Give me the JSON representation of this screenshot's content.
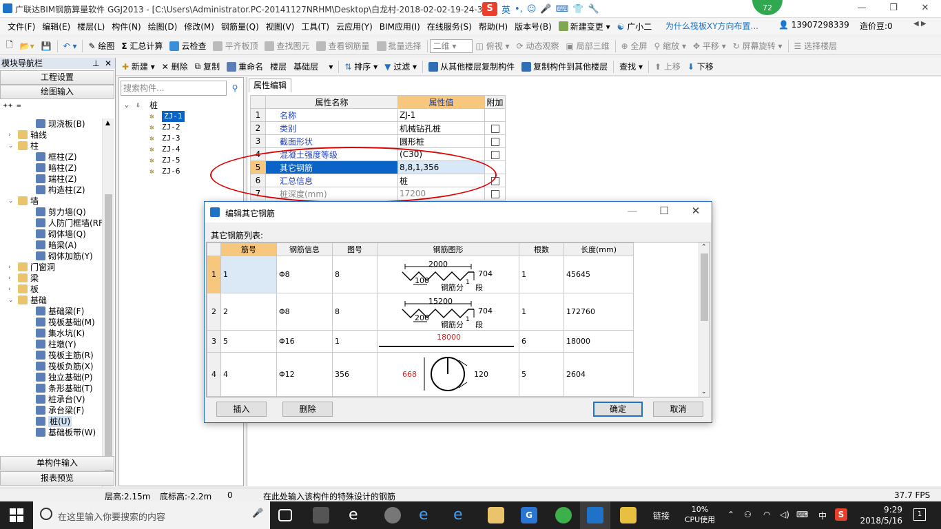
{
  "window": {
    "title": "广联达BIM钢筋算量软件 GGJ2013 - [C:\\Users\\Administrator.PC-20141127NRHM\\Desktop\\白龙村-2018-02-02-19-24-35",
    "ime_label": "英",
    "score": "72",
    "min": "—",
    "max": "❐",
    "close": "✕"
  },
  "menu": {
    "items": [
      "文件(F)",
      "编辑(E)",
      "楼层(L)",
      "构件(N)",
      "绘图(D)",
      "修改(M)",
      "钢筋量(Q)",
      "视图(V)",
      "工具(T)",
      "云应用(Y)",
      "BIM应用(I)",
      "在线服务(S)",
      "帮助(H)",
      "版本号(B)"
    ],
    "new_change": "新建变更",
    "assistant": "广小二",
    "question": "为什么筏板XY方向布置...",
    "phone": "13907298339",
    "beans": "造价豆:0"
  },
  "toolbar1": {
    "draw": "绘图",
    "sum": "汇总计算",
    "cloud_check": "云检查",
    "flush_slab": "平齐板顶",
    "find_element": "查找图元",
    "view_rebar": "查看钢筋量",
    "batch_select": "批量选择",
    "view_mode": "二维",
    "top_view": "俯视",
    "dynamic": "动态观察",
    "local3d": "局部三维",
    "fullscreen": "全屏",
    "zoom": "缩放",
    "pan": "平移",
    "rotate": "屏幕旋转",
    "select_floor": "选择楼层"
  },
  "toolbar2": {
    "nav_title": "模块导航栏",
    "new": "新建",
    "delete": "删除",
    "copy": "复制",
    "rename": "重命名",
    "floor": "楼层",
    "floor_value": "基础层",
    "sort": "排序",
    "filter": "过滤",
    "copy_from": "从其他楼层复制构件",
    "copy_to": "复制构件到其他楼层",
    "find": "查找",
    "up": "上移",
    "down": "下移"
  },
  "leftnav": {
    "project_settings": "工程设置",
    "drawing_input": "绘图输入",
    "single_input": "单构件输入",
    "report_preview": "报表预览",
    "tree": [
      {
        "label": "现浇板(B)",
        "level": 2,
        "type": "item"
      },
      {
        "label": "轴线",
        "level": 1,
        "type": "folder",
        "exp": "›"
      },
      {
        "label": "柱",
        "level": 1,
        "type": "folder",
        "exp": "⌄"
      },
      {
        "label": "框柱(Z)",
        "level": 2,
        "type": "item"
      },
      {
        "label": "暗柱(Z)",
        "level": 2,
        "type": "item"
      },
      {
        "label": "端柱(Z)",
        "level": 2,
        "type": "item"
      },
      {
        "label": "构造柱(Z)",
        "level": 2,
        "type": "item"
      },
      {
        "label": "墙",
        "level": 1,
        "type": "folder",
        "exp": "⌄"
      },
      {
        "label": "剪力墙(Q)",
        "level": 2,
        "type": "item"
      },
      {
        "label": "人防门框墙(RF",
        "level": 2,
        "type": "item"
      },
      {
        "label": "砌体墙(Q)",
        "level": 2,
        "type": "item"
      },
      {
        "label": "暗梁(A)",
        "level": 2,
        "type": "item"
      },
      {
        "label": "砌体加筋(Y)",
        "level": 2,
        "type": "item"
      },
      {
        "label": "门窗洞",
        "level": 1,
        "type": "folder",
        "exp": "›"
      },
      {
        "label": "梁",
        "level": 1,
        "type": "folder",
        "exp": "›"
      },
      {
        "label": "板",
        "level": 1,
        "type": "folder",
        "exp": "›"
      },
      {
        "label": "基础",
        "level": 1,
        "type": "folder",
        "exp": "⌄"
      },
      {
        "label": "基础梁(F)",
        "level": 2,
        "type": "item"
      },
      {
        "label": "筏板基础(M)",
        "level": 2,
        "type": "item"
      },
      {
        "label": "集水坑(K)",
        "level": 2,
        "type": "item"
      },
      {
        "label": "柱墩(Y)",
        "level": 2,
        "type": "item"
      },
      {
        "label": "筏板主筋(R)",
        "level": 2,
        "type": "item"
      },
      {
        "label": "筏板负筋(X)",
        "level": 2,
        "type": "item"
      },
      {
        "label": "独立基础(P)",
        "level": 2,
        "type": "item"
      },
      {
        "label": "条形基础(T)",
        "level": 2,
        "type": "item"
      },
      {
        "label": "桩承台(V)",
        "level": 2,
        "type": "item"
      },
      {
        "label": "承台梁(F)",
        "level": 2,
        "type": "item"
      },
      {
        "label": "桩(U)",
        "level": 2,
        "type": "item",
        "selected": true
      },
      {
        "label": "基础板带(W)",
        "level": 2,
        "type": "item"
      }
    ]
  },
  "comptree": {
    "search_placeholder": "搜索构件...",
    "root": "桩",
    "items": [
      "ZJ-1",
      "ZJ-2",
      "ZJ-3",
      "ZJ-4",
      "ZJ-5",
      "ZJ-6"
    ]
  },
  "props": {
    "tab": "属性编辑",
    "col_name": "属性名称",
    "col_value": "属性值",
    "col_extra": "附加",
    "rows": [
      {
        "n": "1",
        "name": "名称",
        "value": "ZJ-1",
        "chk": false
      },
      {
        "n": "2",
        "name": "类别",
        "value": "机械钻孔桩",
        "chk": true
      },
      {
        "n": "3",
        "name": "截面形状",
        "value": "圆形桩",
        "chk": true
      },
      {
        "n": "4",
        "name": "混凝土强度等级",
        "value": "(C30)",
        "chk": true
      },
      {
        "n": "5",
        "name": "其它钢筋",
        "value": "8,8,1,356",
        "chk": false,
        "selected": true
      },
      {
        "n": "6",
        "name": "汇总信息",
        "value": "桩",
        "chk": true
      },
      {
        "n": "7",
        "name": "桩深度(mm)",
        "value": "17200",
        "chk": true,
        "gray": true
      }
    ]
  },
  "dialog": {
    "title": "编辑其它钢筋",
    "list_label": "其它钢筋列表:",
    "cols": [
      "筋号",
      "钢筋信息",
      "图号",
      "钢筋图形",
      "根数",
      "长度(mm)"
    ],
    "rows": [
      {
        "n": "1",
        "bar": "1",
        "info": "Φ8",
        "fig": "8",
        "count": "1",
        "length": "45645",
        "shape": {
          "type": "zigzag",
          "top": "2000",
          "bottom": "100",
          "side": "704",
          "label": "钢筋分",
          "sub": "1",
          "seg": "段"
        }
      },
      {
        "n": "2",
        "bar": "2",
        "info": "Φ8",
        "fig": "8",
        "count": "1",
        "length": "172760",
        "shape": {
          "type": "zigzag",
          "top": "15200",
          "bottom": "200",
          "side": "704",
          "label": "钢筋分",
          "sub": "1",
          "seg": "段"
        }
      },
      {
        "n": "3",
        "bar": "5",
        "info": "Φ16",
        "fig": "1",
        "count": "6",
        "length": "18000",
        "shape": {
          "type": "straight",
          "top": "18000"
        }
      },
      {
        "n": "4",
        "bar": "4",
        "info": "Φ12",
        "fig": "356",
        "count": "5",
        "length": "2604",
        "shape": {
          "type": "circle",
          "left": "668",
          "right": "120"
        }
      }
    ],
    "insert": "插入",
    "delete": "删除",
    "ok": "确定",
    "cancel": "取消"
  },
  "status": {
    "floor_height": "层高:2.15m",
    "base_elev": "底标高:-2.2m",
    "zero": "0",
    "hint": "在此处输入该构件的特殊设计的钢筋",
    "fps": "37.7 FPS"
  },
  "taskbar": {
    "search_placeholder": "在这里输入你要搜索的内容",
    "link": "链接",
    "cpu_pct": "10%",
    "cpu_label": "CPU使用",
    "lang": "中",
    "time": "9:29",
    "date": "2018/5/16",
    "notif": "1"
  },
  "colors": {
    "accent": "#1e73c8",
    "header_highlight": "#f6c77d",
    "selection": "#0a64c8",
    "annotation_red": "#e00000"
  }
}
